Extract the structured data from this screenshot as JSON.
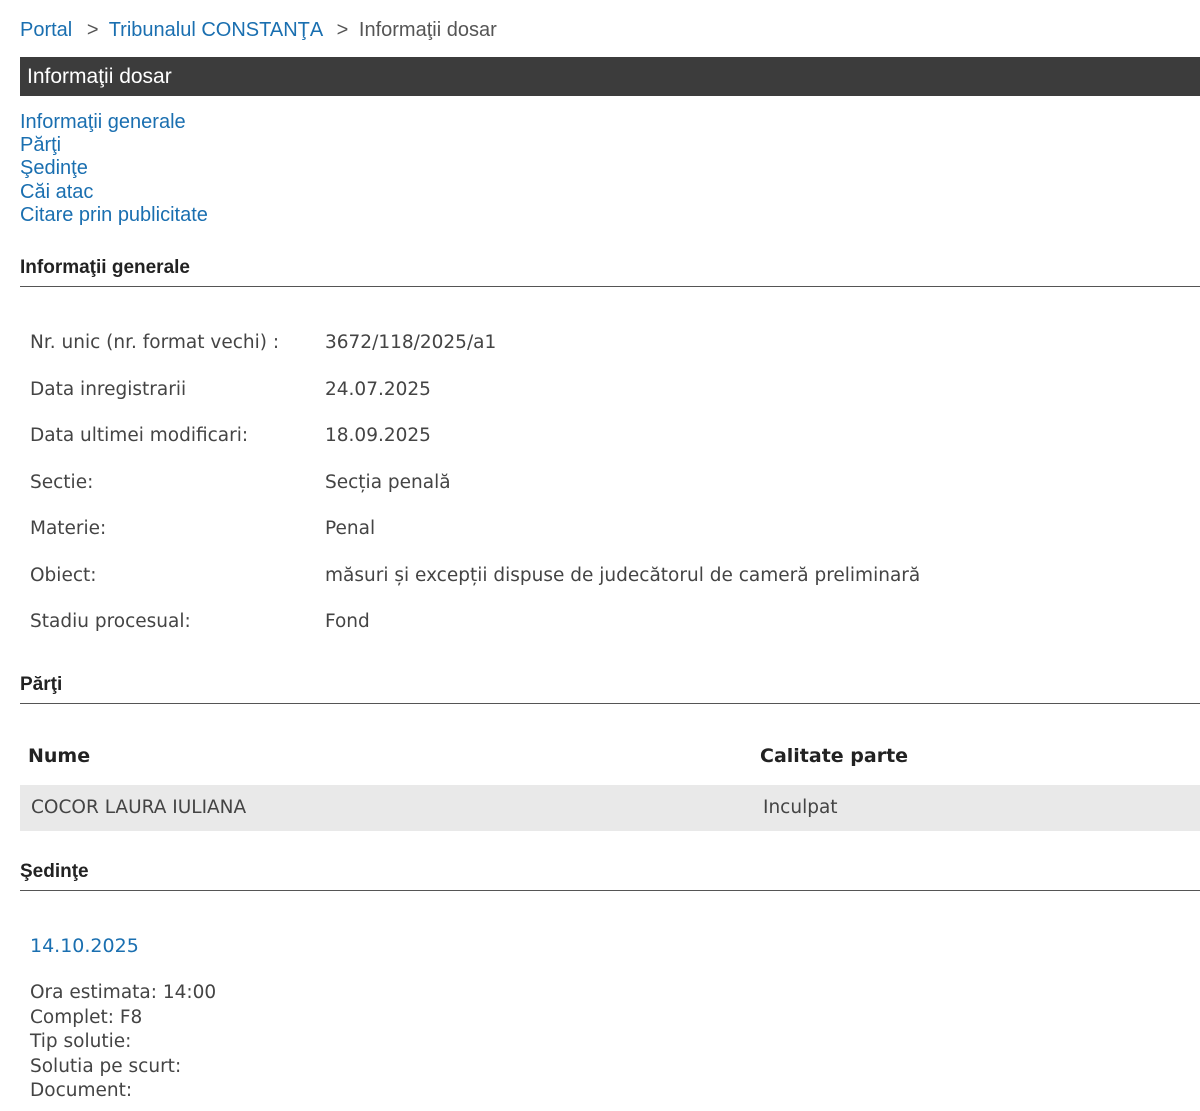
{
  "breadcrumb": {
    "items": [
      "Portal",
      "Tribunalul CONSTANŢA"
    ],
    "separator": ">",
    "current": "Informaţii dosar"
  },
  "title": "Informaţii dosar",
  "anchors": [
    "Informaţii generale",
    "Părţi",
    "Şedinţe",
    "Căi atac",
    "Citare prin publicitate"
  ],
  "general": {
    "heading": "Informaţii generale",
    "rows": [
      {
        "label": "Nr. unic (nr. format vechi) :",
        "value": "3672/118/2025/a1"
      },
      {
        "label": "Data inregistrarii",
        "value": "24.07.2025"
      },
      {
        "label": "Data ultimei modificari:",
        "value": "18.09.2025"
      },
      {
        "label": "Sectie:",
        "value": "Secția penală"
      },
      {
        "label": "Materie:",
        "value": "Penal"
      },
      {
        "label": "Obiect:",
        "value": "măsuri și excepții dispuse de judecătorul de cameră preliminară"
      },
      {
        "label": "Stadiu procesual:",
        "value": "Fond"
      }
    ]
  },
  "parties": {
    "heading": "Părţi",
    "columns": [
      "Nume",
      "Calitate parte"
    ],
    "rows": [
      [
        "COCOR LAURA IULIANA",
        "Inculpat"
      ]
    ]
  },
  "sessions": {
    "heading": "Şedinţe",
    "items": [
      {
        "date": "14.10.2025",
        "details": [
          "Ora estimata: 14:00",
          "Complet: F8",
          "Tip solutie:",
          "Solutia pe scurt:",
          "Document:"
        ]
      }
    ]
  },
  "colors": {
    "link": "#1a6fb0",
    "titlebar_bg": "#3c3c3c",
    "row_highlight": "#e9e9e9"
  }
}
